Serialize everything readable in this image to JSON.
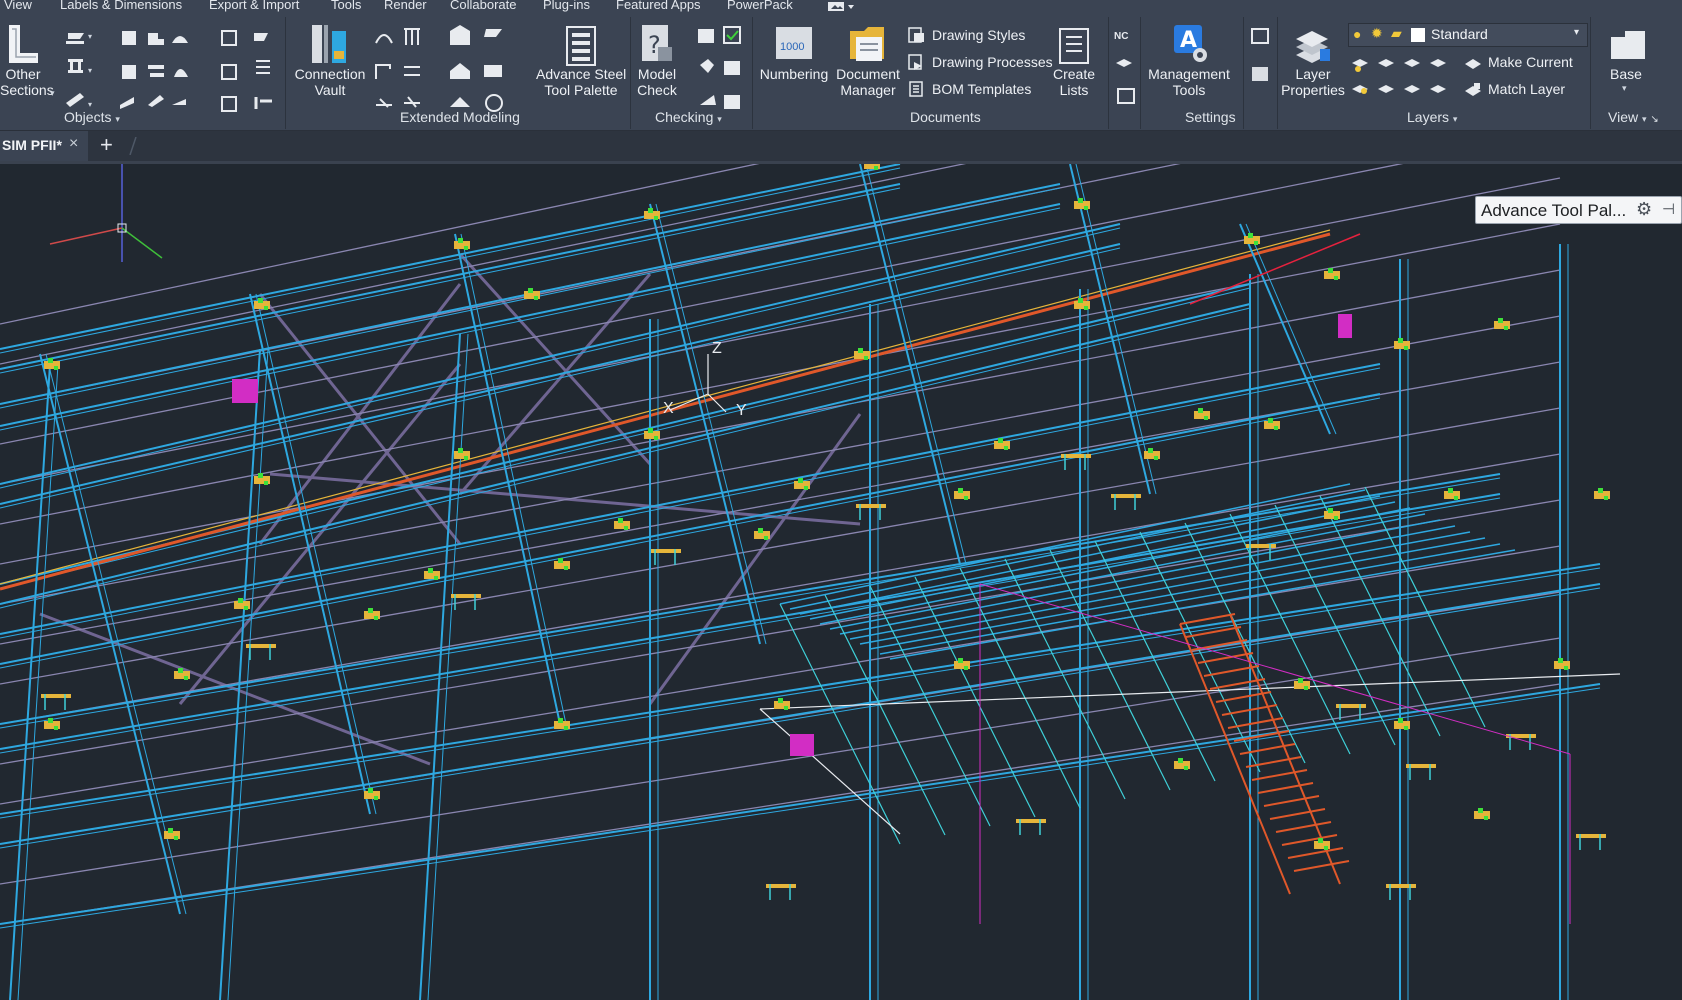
{
  "menu": [
    "View",
    "Labels & Dimensions",
    "Export & Import",
    "Tools",
    "Render",
    "Collaborate",
    "Plug-ins",
    "Featured Apps",
    "PowerPack"
  ],
  "ribbon": {
    "objects": {
      "tool_line1": "Other",
      "tool_line2": "Sections",
      "title": "Objects"
    },
    "extended_modeling": {
      "connection_vault_1": "Connection",
      "connection_vault_2": "Vault",
      "tool_palette_1": "Advance Steel",
      "tool_palette_2": "Tool Palette",
      "title": "Extended Modeling"
    },
    "checking": {
      "model_check_1": "Model",
      "model_check_2": "Check",
      "title": "Checking"
    },
    "documents": {
      "numbering": "Numbering",
      "numbering_badge": "1000",
      "doc_manager_1": "Document",
      "doc_manager_2": "Manager",
      "drawing_styles": "Drawing Styles",
      "drawing_processes": "Drawing Processes",
      "bom_templates": "BOM Templates",
      "create_lists_1": "Create",
      "create_lists_2": "Lists",
      "nc_label": "NC",
      "title": "Documents"
    },
    "settings": {
      "mgmt_1": "Management",
      "mgmt_2": "Tools",
      "title": "Settings"
    },
    "layers": {
      "layer_props_1": "Layer",
      "layer_props_2": "Properties",
      "current_layer": "Standard",
      "make_current": "Make Current",
      "match_layer": "Match Layer",
      "title": "Layers"
    },
    "view": {
      "base": "Base",
      "title": "View"
    }
  },
  "tabs": {
    "active": "SIM PFII*",
    "close": "×",
    "add": "+"
  },
  "viewport": {
    "ucs_z": "Z",
    "ucs_x": "X",
    "ucs_y": "Y",
    "tooltip": "Advance Tool Pal...",
    "colors": {
      "bg": "#212830",
      "beam": "#2ea8e0",
      "purlin": "#8a86b0",
      "brace": "#6f6592",
      "plate": "#e6b53a",
      "bolt": "#3fe03a",
      "highlight": "#e6223e",
      "magenta": "#d22dc4",
      "stair": "#e0582a"
    }
  }
}
